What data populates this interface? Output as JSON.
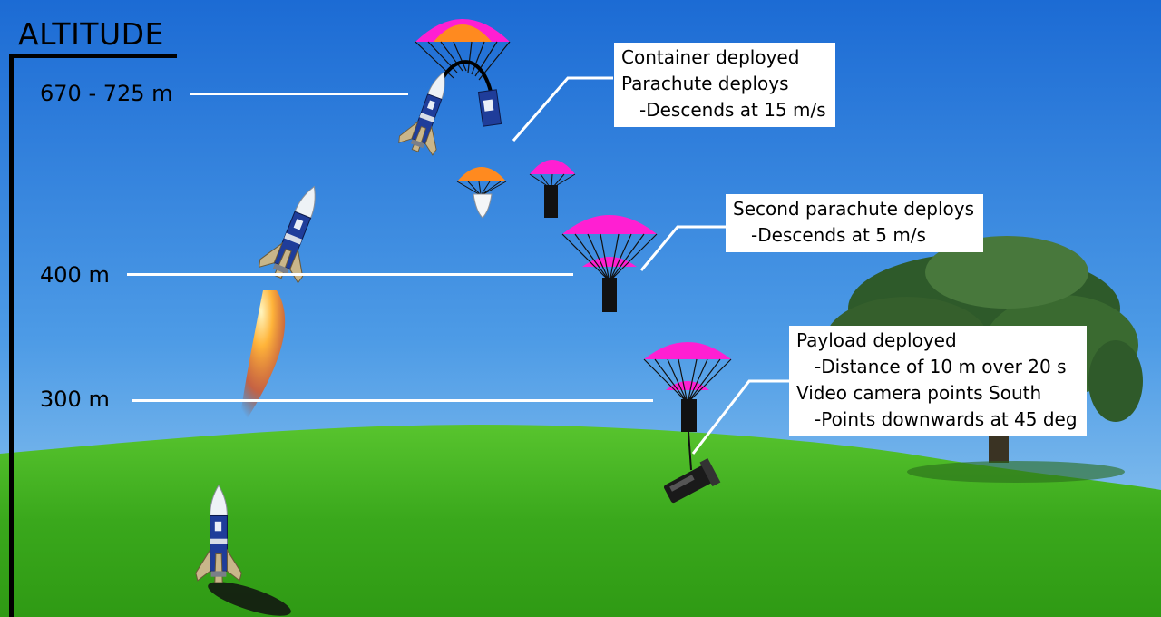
{
  "title": "ALTITUDE",
  "altitudes": [
    {
      "label": "670 - 725 m"
    },
    {
      "label": "400 m"
    },
    {
      "label": "300 m"
    }
  ],
  "callouts": [
    {
      "lines": [
        "Container deployed",
        "Parachute deploys",
        "-Descends at 15 m/s"
      ]
    },
    {
      "lines": [
        "Second parachute deploys",
        "-Descends at 5 m/s"
      ]
    },
    {
      "lines": [
        "Payload deployed",
        "-Distance of 10 m over 20 s",
        "Video camera points South",
        "-Points downwards at 45 deg"
      ]
    }
  ],
  "colors": {
    "sky_top": "#1f6fd6",
    "sky_bottom": "#8ec8ee",
    "grass": "#3fae1f",
    "canopy_magenta": "#ff1fd2",
    "canopy_orange": "#ff8a1f",
    "rocket_body": "#1f3d9a",
    "fin": "#c9b68a"
  },
  "icons": [
    "rocket-icon",
    "parachute-icon",
    "container-icon",
    "nose-cone-icon",
    "flame-icon",
    "camera-icon",
    "tree-icon"
  ]
}
